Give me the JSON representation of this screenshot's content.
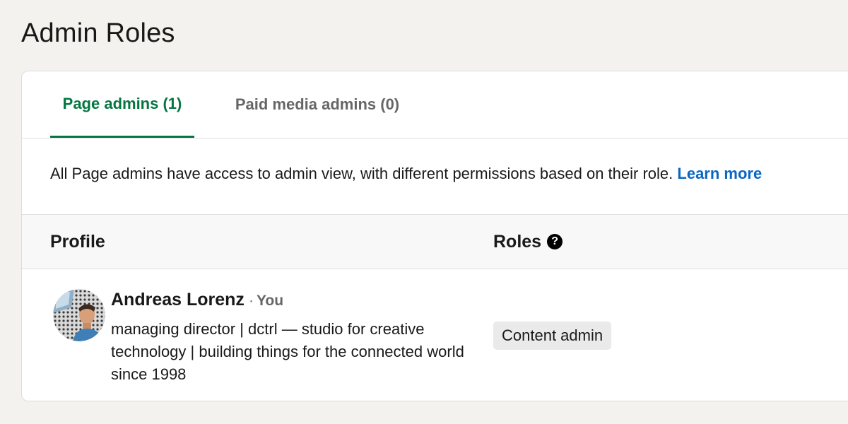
{
  "page": {
    "title": "Admin Roles"
  },
  "tabs": [
    {
      "label": "Page admins (1)",
      "active": true
    },
    {
      "label": "Paid media admins (0)",
      "active": false
    }
  ],
  "info": {
    "text": "All Page admins have access to admin view, with different permissions based on their role. ",
    "link_label": "Learn more"
  },
  "table": {
    "headers": {
      "profile": "Profile",
      "roles": "Roles",
      "roles_help_icon": "question-circle-icon"
    },
    "rows": [
      {
        "name": "Andreas Lorenz",
        "you_separator": "·",
        "you_label": "You",
        "headline": "managing director | dctrl — studio for creative technology | building things for the connected world since 1998",
        "role": "Content admin"
      }
    ]
  },
  "colors": {
    "accent_green": "#057642",
    "link_blue": "#0a66c2",
    "page_bg": "#f3f2ef"
  }
}
